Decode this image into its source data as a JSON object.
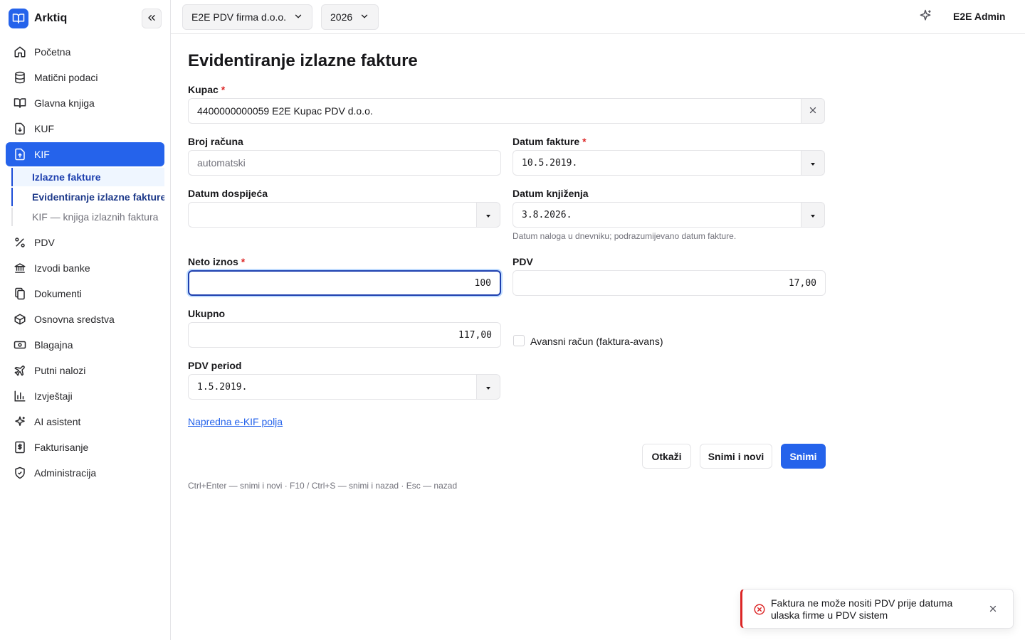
{
  "app": {
    "name": "Arktiq"
  },
  "sidebar": {
    "items": [
      {
        "label": "Početna",
        "icon": "home-icon"
      },
      {
        "label": "Matični podaci",
        "icon": "database-icon"
      },
      {
        "label": "Glavna knjiga",
        "icon": "book-icon"
      },
      {
        "label": "KUF",
        "icon": "file-in-icon"
      },
      {
        "label": "KIF",
        "icon": "file-out-icon",
        "active": true
      },
      {
        "label": "PDV",
        "icon": "percent-icon"
      },
      {
        "label": "Izvodi banke",
        "icon": "bank-icon"
      },
      {
        "label": "Dokumenti",
        "icon": "documents-icon"
      },
      {
        "label": "Osnovna sredstva",
        "icon": "box-icon"
      },
      {
        "label": "Blagajna",
        "icon": "cash-icon"
      },
      {
        "label": "Putni nalozi",
        "icon": "plane-icon"
      },
      {
        "label": "Izvještaji",
        "icon": "bar-chart-icon"
      },
      {
        "label": "AI asistent",
        "icon": "sparkles-icon"
      },
      {
        "label": "Fakturisanje",
        "icon": "invoice-dollar-icon"
      },
      {
        "label": "Administracija",
        "icon": "shield-icon"
      }
    ],
    "kif_sub": [
      {
        "label": "Izlazne fakture"
      },
      {
        "label": "Evidentiranje izlazne fakture"
      },
      {
        "label": "KIF — knjiga izlaznih faktura"
      }
    ]
  },
  "topbar": {
    "company": "E2E PDV firma d.o.o.",
    "year": "2026",
    "user": "E2E Admin"
  },
  "form": {
    "title": "Evidentiranje izlazne fakture",
    "kupac": {
      "label": "Kupac",
      "value": "4400000000059 E2E Kupac PDV d.o.o."
    },
    "broj_racuna": {
      "label": "Broj računa",
      "placeholder": "automatski"
    },
    "datum_fakture": {
      "label": "Datum fakture",
      "value": "10.5.2019."
    },
    "datum_dospijeca": {
      "label": "Datum dospijeća",
      "value": ""
    },
    "datum_knjizenja": {
      "label": "Datum knjiženja",
      "value": "3.8.2026.",
      "hint": "Datum naloga u dnevniku; podrazumijevano datum fakture."
    },
    "neto_iznos": {
      "label": "Neto iznos",
      "value": "100"
    },
    "pdv": {
      "label": "PDV",
      "value": "17,00"
    },
    "ukupno": {
      "label": "Ukupno",
      "value": "117,00"
    },
    "avansni": {
      "label": "Avansni račun (faktura-avans)",
      "checked": false
    },
    "pdv_period": {
      "label": "PDV period",
      "value": "1.5.2019."
    },
    "advanced_link": "Napredna e-KIF polja",
    "buttons": {
      "cancel": "Otkaži",
      "save_new": "Snimi i novi",
      "save": "Snimi"
    },
    "shortcuts": "Ctrl+Enter — snimi i novi · F10 / Ctrl+S — snimi i nazad · Esc — nazad"
  },
  "toast": {
    "message": "Faktura ne može nositi PDV prije datuma ulaska firme u PDV sistem",
    "color": "#dc2626"
  },
  "colors": {
    "accent": "#2563eb",
    "danger": "#dc2626"
  }
}
